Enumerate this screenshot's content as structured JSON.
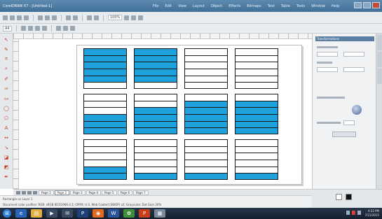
{
  "window": {
    "title": "CorelDRAW X7 - [Untitled-1]",
    "menu": [
      "File",
      "Edit",
      "View",
      "Layout",
      "Object",
      "Effects",
      "Bitmaps",
      "Text",
      "Table",
      "Tools",
      "Window",
      "Help"
    ]
  },
  "property_bar": {
    "page_size": "A4",
    "zoom": "100%"
  },
  "rows_per_card": 6,
  "cards": [
    {
      "filled": [
        true,
        true,
        true,
        true,
        true,
        false
      ]
    },
    {
      "filled": [
        true,
        true,
        true,
        true,
        true,
        false
      ]
    },
    {
      "filled": [
        false,
        false,
        false,
        false,
        false,
        false
      ]
    },
    {
      "filled": [
        false,
        false,
        false,
        false,
        false,
        false
      ]
    },
    {
      "filled": [
        false,
        false,
        false,
        true,
        true,
        true
      ]
    },
    {
      "filled": [
        false,
        false,
        true,
        true,
        true,
        true
      ]
    },
    {
      "filled": [
        false,
        true,
        true,
        true,
        true,
        true
      ]
    },
    {
      "filled": [
        false,
        true,
        true,
        true,
        true,
        true
      ]
    },
    {
      "filled": [
        false,
        false,
        false,
        false,
        true,
        true
      ]
    },
    {
      "filled": [
        false,
        false,
        false,
        false,
        false,
        true
      ]
    },
    {
      "filled": [
        false,
        false,
        false,
        false,
        false,
        true
      ]
    },
    {
      "filled": [
        false,
        false,
        false,
        false,
        false,
        true
      ]
    }
  ],
  "fill_color": "#1ea0dc",
  "docker": {
    "title": "Transformations"
  },
  "page_tabs": [
    "Page 1",
    "Page 2",
    "Page 3",
    "Page 4",
    "Page 5",
    "Page 6",
    "Page 7"
  ],
  "active_page_tab": 1,
  "status": {
    "line1": "Rectangle on Layer 1",
    "line2": "Document color profiles: RGB: sRGB IEC61966-2.1; CMYK: U.S. Web Coated (SWOP) v2; Grayscale: Dot Gain 20%"
  },
  "taskbar": {
    "apps": [
      "start-button",
      "ie-icon",
      "explorer-icon",
      "media-icon",
      "mail-icon",
      "photoshop-icon",
      "firefox-icon",
      "word-icon",
      "coreldraw-icon",
      "powerpoint-icon",
      "app-icon"
    ],
    "time": "4:32 PM",
    "date": "7/21/2015"
  }
}
